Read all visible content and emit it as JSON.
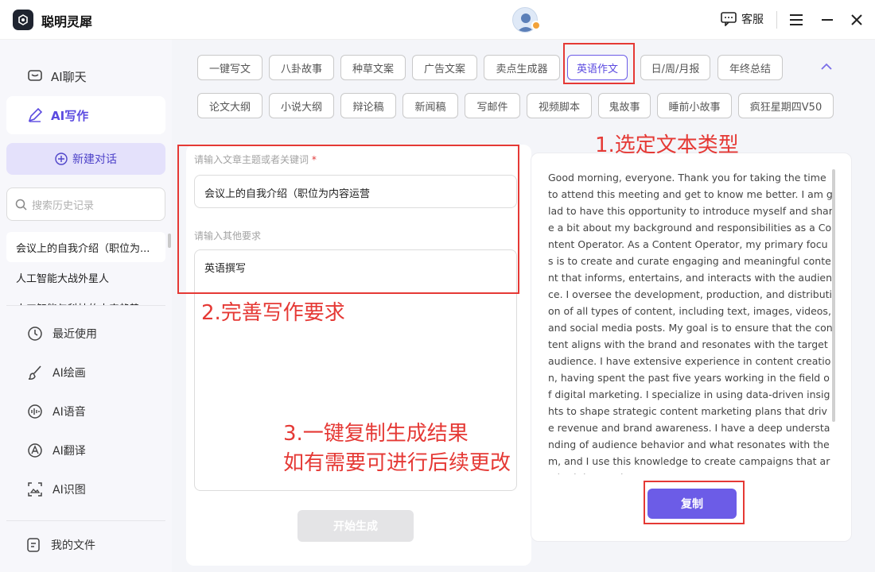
{
  "app": {
    "title": "聪明灵犀"
  },
  "titlebar": {
    "service_label": "客服"
  },
  "sidebar": {
    "nav": [
      {
        "label": "AI聊天",
        "icon": "chat-icon"
      },
      {
        "label": "AI写作",
        "icon": "pen-icon"
      }
    ],
    "new_chat_label": "新建对话",
    "search_placeholder": "搜索历史记录",
    "history": [
      "会议上的自我介绍（职位为...",
      "人工智能大战外星人",
      "人工智能与科技的未来趋势"
    ],
    "tools": [
      {
        "label": "最近使用",
        "icon": "history-icon"
      },
      {
        "label": "AI绘画",
        "icon": "brush-icon"
      },
      {
        "label": "AI语音",
        "icon": "voice-icon"
      },
      {
        "label": "AI翻译",
        "icon": "translate-icon"
      },
      {
        "label": "AI识图",
        "icon": "image-recognize-icon"
      }
    ],
    "my_files_label": "我的文件"
  },
  "tags": {
    "row1": [
      "一键写文",
      "八卦故事",
      "种草文案",
      "广告文案",
      "卖点生成器",
      "英语作文",
      "日/周/月报",
      "年终总结"
    ],
    "row2": [
      "论文大纲",
      "小说大纲",
      "辩论稿",
      "新闻稿",
      "写邮件",
      "视频脚本",
      "鬼故事",
      "睡前小故事",
      "疯狂星期四V50"
    ],
    "active": "英语作文"
  },
  "form": {
    "topic_label": "请输入文章主题或者关键词",
    "required_mark": "*",
    "topic_value": "会议上的自我介绍（职位为内容运营",
    "other_label": "请输入其他要求",
    "other_value": "英语撰写",
    "start_label": "开始生成"
  },
  "result": {
    "text": "Good morning, everyone. Thank you for taking the time to attend this meeting and get to know me better. I am glad to have this opportunity to introduce myself and share a bit about my background and responsibilities as a Content Operator. As a Content Operator, my primary focus is to create and curate engaging and meaningful content that informs, entertains, and interacts with the audience. I oversee the development, production, and distribution of all types of content, including text, images, videos, and social media posts. My goal is to ensure that the content aligns with the brand and resonates with the target audience. I have extensive experience in content creation, having spent the past five years working in the field of digital marketing. I specialize in using data-driven insights to shape strategic content marketing plans that drive revenue and brand awareness. I have a deep understanding of audience behavior and what resonates with them, and I use this knowledge to create campaigns that are both innovative a",
    "copy_label": "复制"
  },
  "annotations": {
    "step1": "1.选定文本类型",
    "step2": "2.完善写作要求",
    "step3_line1": "3.一键复制生成结果",
    "step3_line2": "如有需要可进行后续更改"
  },
  "colors": {
    "accent": "#6c5ce7",
    "annotation": "#e53935"
  }
}
